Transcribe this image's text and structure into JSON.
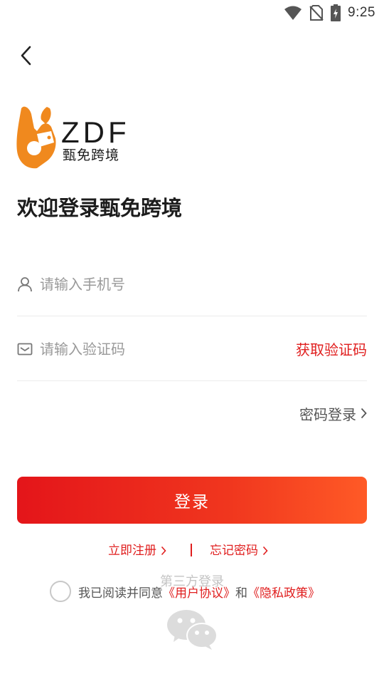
{
  "status_bar": {
    "time": "9:25"
  },
  "logo": {
    "brand": "ZDF",
    "subtitle": "甄免跨境"
  },
  "welcome_title": "欢迎登录甄免跨境",
  "form": {
    "phone": {
      "value": "",
      "placeholder": "请输入手机号"
    },
    "code": {
      "value": "",
      "placeholder": "请输入验证码"
    },
    "get_code_label": "获取验证码",
    "password_login_label": "密码登录"
  },
  "login_button_label": "登录",
  "links": {
    "register": "立即注册",
    "forgot_password": "忘记密码"
  },
  "third_party": {
    "title": "第三方登录"
  },
  "agreement": {
    "prefix": "我已阅读并同意",
    "user_agreement": "《用户协议》",
    "and": "和",
    "privacy_policy": "《隐私政策》"
  },
  "colors": {
    "accent": "#e01e1e",
    "button_start": "#e4151a",
    "button_end": "#ff5a26",
    "logo_orange": "#f0891e"
  }
}
